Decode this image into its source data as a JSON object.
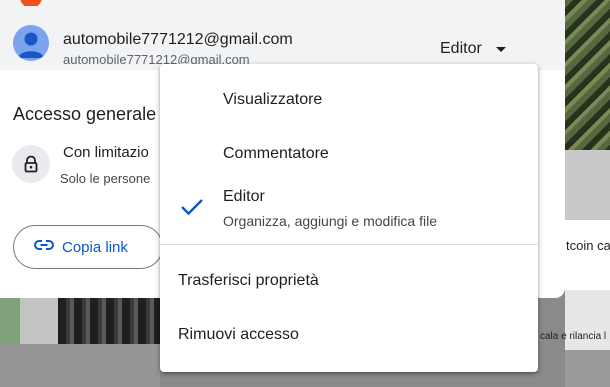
{
  "background": {
    "right_text_1": "tcoin ca",
    "right_text_2": "cala e rilancia l"
  },
  "owner": {
    "name": "automobile7771212@gmail.com",
    "email": "automobile7771212@gmail.com",
    "role": "Editor",
    "avatar_icon": "person-icon"
  },
  "general_access": {
    "heading": "Accesso generale",
    "restriction_title": "Con limitazio",
    "restriction_desc": "Solo le persone",
    "lock_icon": "lock-icon"
  },
  "copy_link": {
    "label": "Copia link",
    "icon": "link-icon"
  },
  "role_menu": {
    "items": [
      {
        "label": "Visualizzatore",
        "selected": false
      },
      {
        "label": "Commentatore",
        "selected": false
      },
      {
        "label": "Editor",
        "description": "Organizza, aggiungi e modifica file",
        "selected": true
      }
    ],
    "actions": [
      {
        "label": "Trasferisci proprietà"
      },
      {
        "label": "Rimuovi accesso"
      }
    ],
    "check_icon": "check-icon"
  },
  "colors": {
    "accent": "#0b57d0",
    "text": "#1f1f1f",
    "row_highlight": "#f1f3f4"
  }
}
